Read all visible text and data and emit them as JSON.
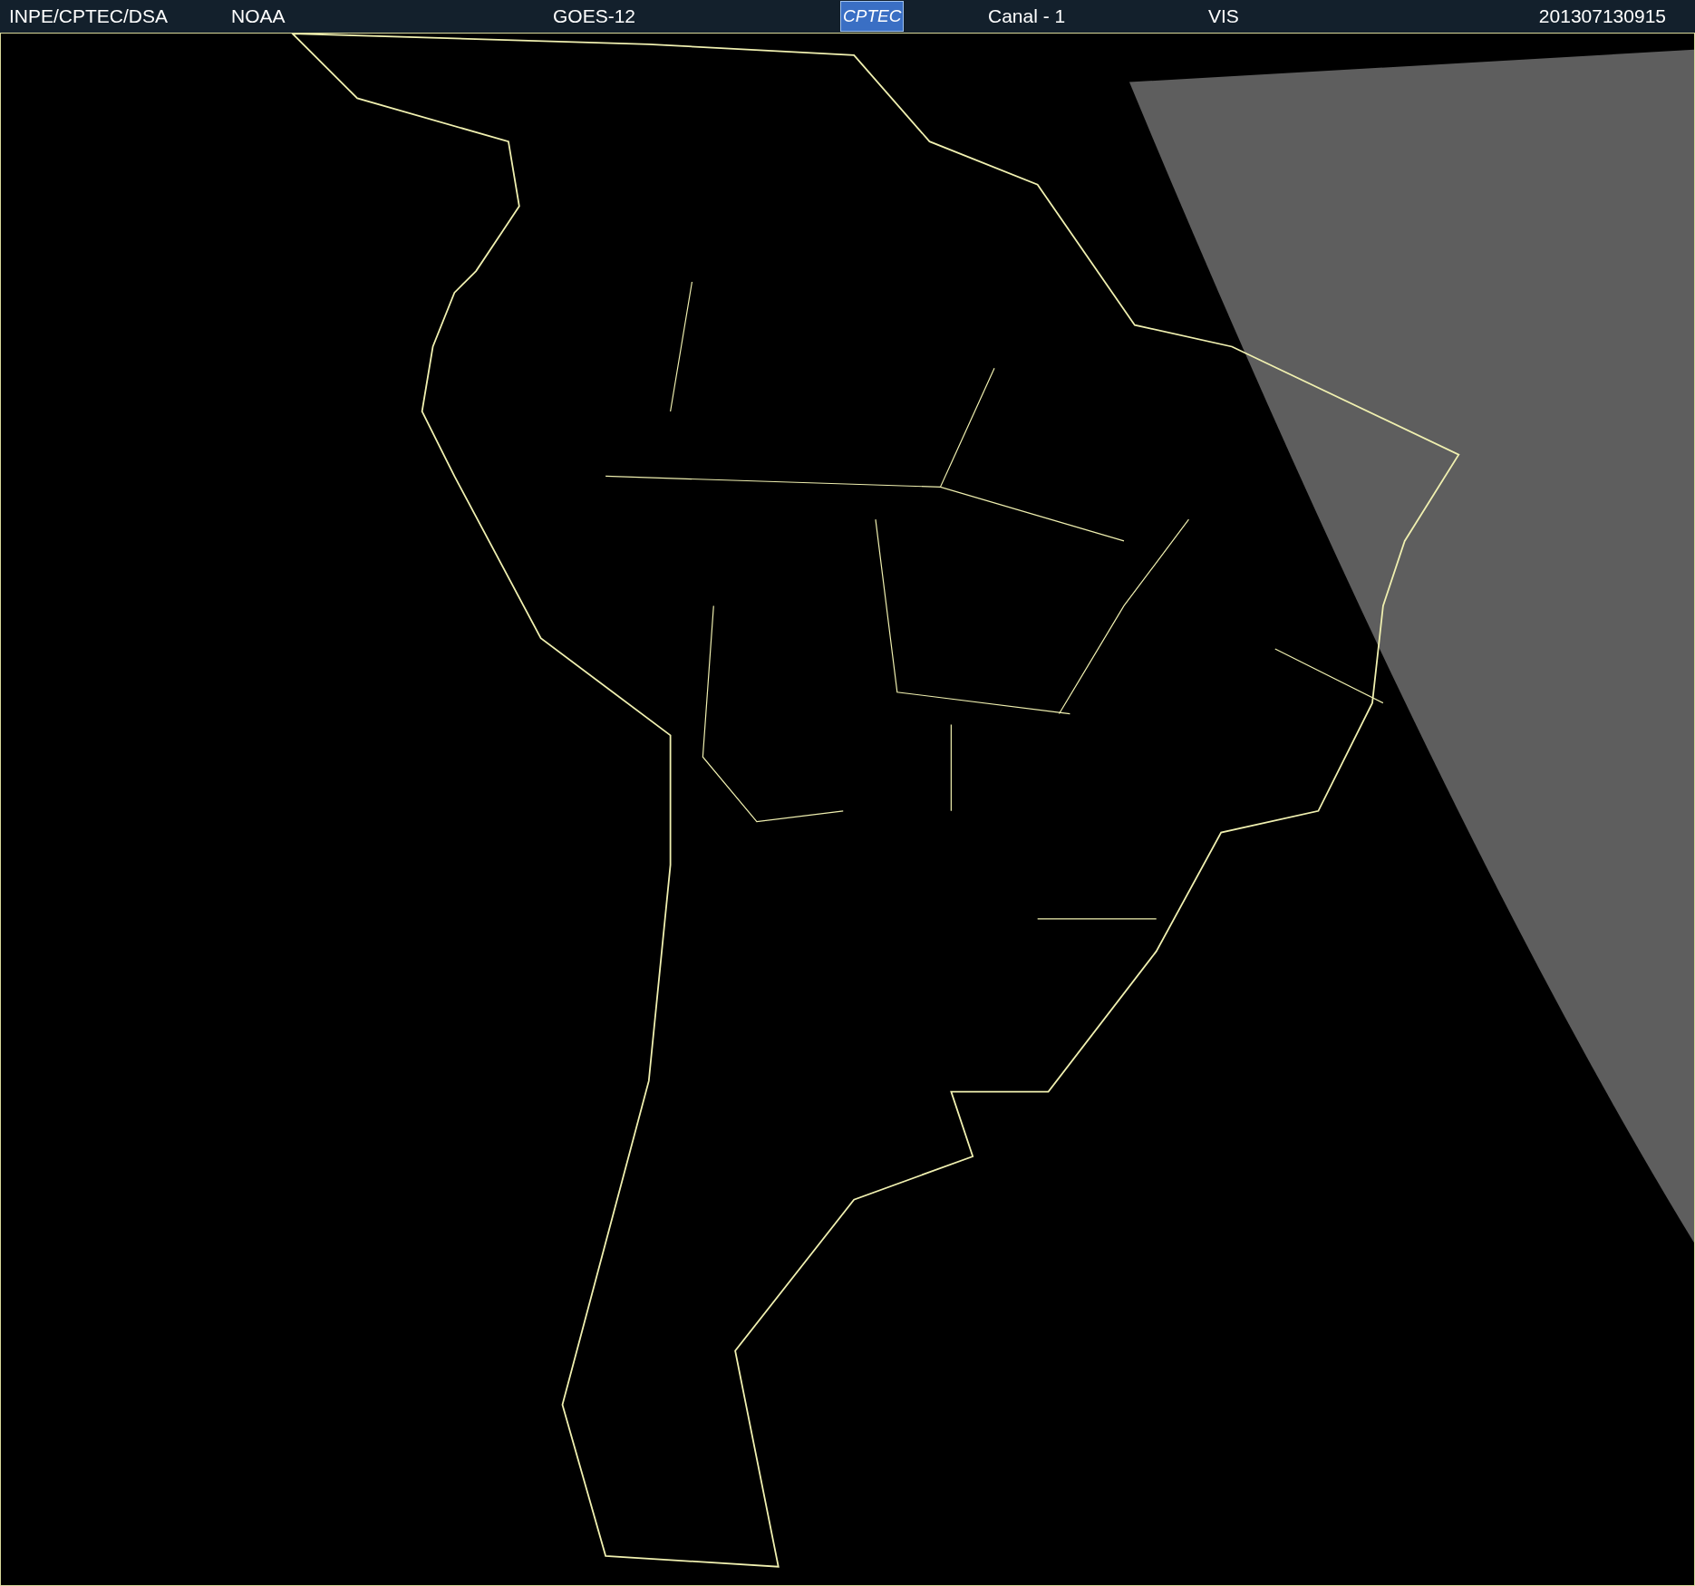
{
  "header": {
    "items": [
      {
        "kind": "text",
        "text": "INPE/CPTEC/DSA"
      },
      {
        "kind": "text",
        "text": "NOAA"
      },
      {
        "kind": "text",
        "text": "GOES-12"
      },
      {
        "kind": "logo",
        "text": "CPTEC"
      },
      {
        "kind": "text",
        "text": "Canal - 1"
      },
      {
        "kind": "text",
        "text": "VIS"
      },
      {
        "kind": "text",
        "text": "201307130915"
      }
    ]
  }
}
